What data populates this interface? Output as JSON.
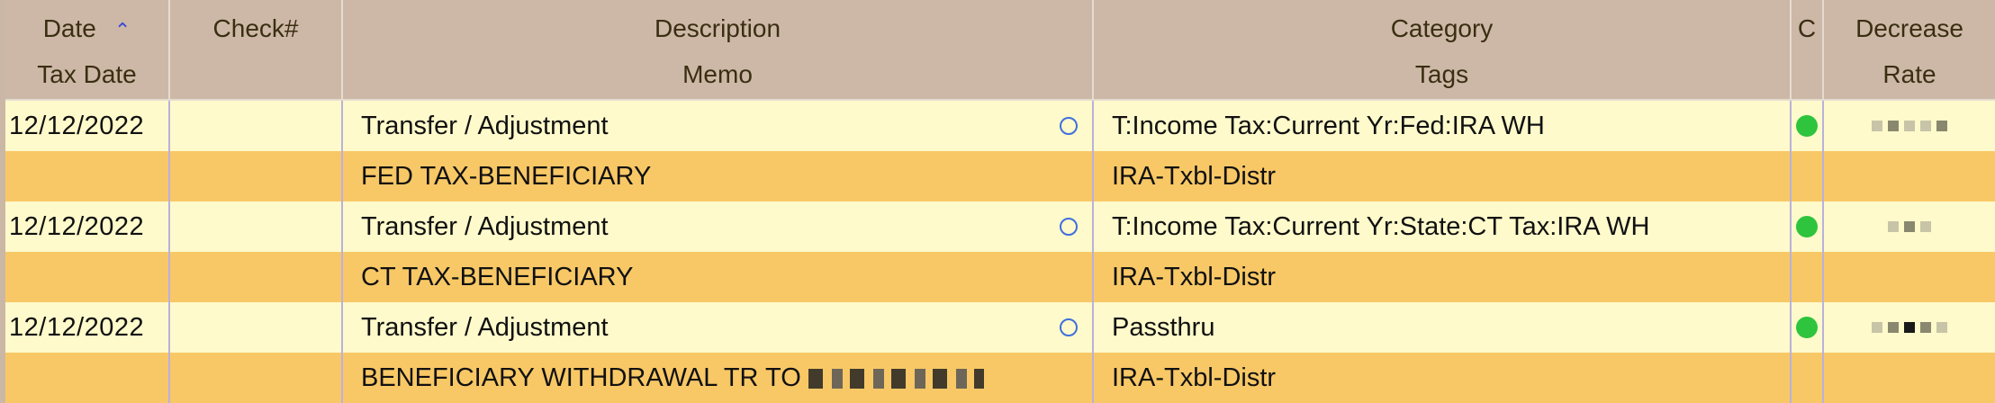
{
  "headers": {
    "row1": {
      "date": "Date",
      "check": "Check#",
      "description": "Description",
      "category": "Category",
      "c": "C",
      "decrease": "Decrease"
    },
    "row2": {
      "tax_date": "Tax Date",
      "memo": "Memo",
      "tags": "Tags",
      "rate": "Rate"
    }
  },
  "sort_indicator": "^",
  "transactions": [
    {
      "date": "12/12/2022",
      "description": "Transfer / Adjustment",
      "category": "T:Income Tax:Current Yr:Fed:IRA WH",
      "memo": "FED TAX-BENEFICIARY",
      "tags": "IRA-Txbl-Distr",
      "cleared": true
    },
    {
      "date": "12/12/2022",
      "description": "Transfer / Adjustment",
      "category": "T:Income Tax:Current Yr:State:CT Tax:IRA WH",
      "memo": "CT  TAX-BENEFICIARY",
      "tags": "IRA-Txbl-Distr",
      "cleared": true
    },
    {
      "date": "12/12/2022",
      "description": "Transfer / Adjustment",
      "category": "Passthru",
      "memo": "BENEFICIARY WITHDRAWAL TR TO ",
      "tags": "IRA-Txbl-Distr",
      "cleared": true
    }
  ],
  "colors": {
    "header_bg": "#cdb8a7",
    "row_light": "#fefacb",
    "row_dark": "#f8c866",
    "cleared_dot": "#2ec43d",
    "link_circle": "#3f6fde"
  }
}
